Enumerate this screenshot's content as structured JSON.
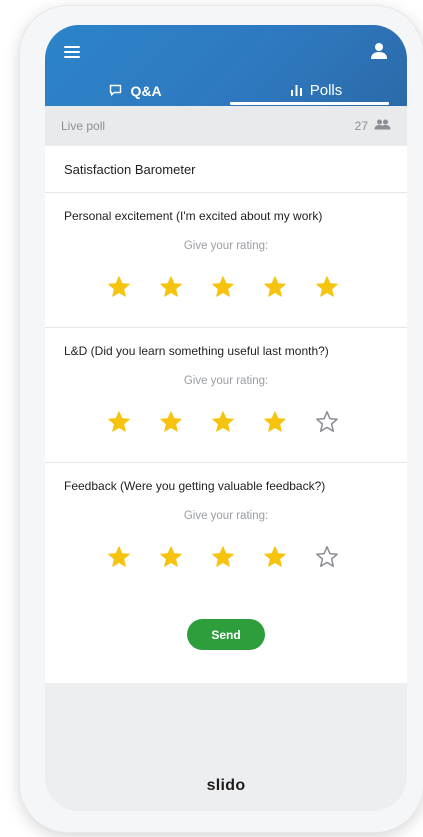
{
  "header": {
    "tabs": [
      {
        "label": "Q&A",
        "icon": "qa-bubble-icon",
        "active": false
      },
      {
        "label": "Polls",
        "icon": "bar-chart-icon",
        "active": true
      }
    ]
  },
  "livebar": {
    "label": "Live poll",
    "participants": "27"
  },
  "poll": {
    "title": "Satisfaction Barometer",
    "questions": [
      {
        "text": "Personal excitement (I'm excited about my work)",
        "hint": "Give your rating:",
        "rating": 5,
        "max": 5
      },
      {
        "text": "L&D (Did you learn something useful last month?)",
        "hint": "Give your rating:",
        "rating": 4,
        "max": 5
      },
      {
        "text": "Feedback (Were you getting valuable feedback?)",
        "hint": "Give your rating:",
        "rating": 4,
        "max": 5
      }
    ],
    "send_label": "Send"
  },
  "brand": "slido",
  "colors": {
    "header": "#2f78bf",
    "star_filled": "#f6c40f",
    "star_empty": "#8a8d91",
    "send": "#2e9e3c"
  }
}
